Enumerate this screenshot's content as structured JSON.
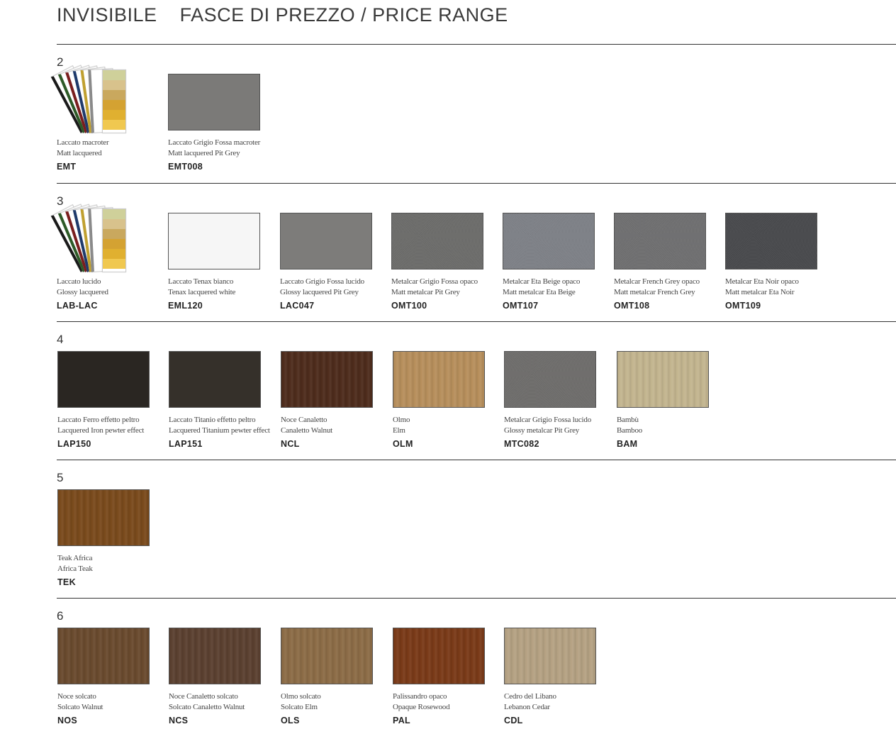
{
  "header": {
    "brand": "INVISIBILE",
    "title": "FASCE DI PREZZO  / PRICE RANGE"
  },
  "bands": [
    {
      "number": "2",
      "items": [
        {
          "line1": "Laccato macroter",
          "line2": "Matt lacquered",
          "code": "EMT",
          "kind": "fan"
        },
        {
          "line1": "Laccato Grigio Fossa macroter",
          "line2": "Matt lacquered Pit Grey",
          "code": "EMT008",
          "kind": "swatch",
          "color": "#7b7a78"
        }
      ]
    },
    {
      "number": "3",
      "items": [
        {
          "line1": "Laccato lucido",
          "line2": "Glossy lacquered",
          "code": "LAB-LAC",
          "kind": "fan"
        },
        {
          "line1": "Laccato Tenax bianco",
          "line2": "Tenax lacquered white",
          "code": "EML120",
          "kind": "swatch",
          "color": "#f6f6f6"
        },
        {
          "line1": "Laccato Grigio Fossa lucido",
          "line2": "Glossy lacquered Pit Grey",
          "code": "LAC047",
          "kind": "swatch",
          "color": "#7d7c7a"
        },
        {
          "line1": "Metalcar Grigio Fossa opaco",
          "line2": "Matt metalcar Pit Grey",
          "code": "OMT100",
          "kind": "swatch",
          "color": "#6c6c6a"
        },
        {
          "line1": "Metalcar Eta Beige opaco",
          "line2": "Matt metalcar Eta Beige",
          "code": "OMT107",
          "kind": "swatch",
          "color": "#7e8187"
        },
        {
          "line1": "Metalcar French Grey opaco",
          "line2": "Matt metalcar French Grey",
          "code": "OMT108",
          "kind": "swatch",
          "color": "#6f6f70"
        },
        {
          "line1": "Metalcar Eta Noir opaco",
          "line2": "Matt metalcar Eta Noir",
          "code": "OMT109",
          "kind": "swatch",
          "color": "#48494c"
        }
      ]
    },
    {
      "number": "4",
      "items": [
        {
          "line1": "Laccato Ferro effetto peltro",
          "line2": "Lacquered Iron pewter effect",
          "code": "LAP150",
          "kind": "swatch",
          "color": "#2a2622"
        },
        {
          "line1": "Laccato Titanio effetto peltro",
          "line2": "Lacquered Titanium pewter effect",
          "code": "LAP151",
          "kind": "swatch",
          "color": "#35302a"
        },
        {
          "line1": "Noce Canaletto",
          "line2": "Canaletto Walnut",
          "code": "NCL",
          "kind": "swatch",
          "color": "#4e2c1c"
        },
        {
          "line1": "Olmo",
          "line2": "Elm",
          "code": "OLM",
          "kind": "swatch",
          "color": "#b78f5c"
        },
        {
          "line1": "Metalcar Grigio Fossa lucido",
          "line2": "Glossy metalcar Pit Grey",
          "code": "MTC082",
          "kind": "swatch",
          "color": "#6e6d6b"
        },
        {
          "line1": "Bambù",
          "line2": "Bamboo",
          "code": "BAM",
          "kind": "swatch",
          "color": "#c3b58f"
        }
      ]
    },
    {
      "number": "5",
      "items": [
        {
          "line1": "Teak Africa",
          "line2": "Africa Teak",
          "code": "TEK",
          "kind": "swatch",
          "color": "#7a4a1c"
        }
      ]
    },
    {
      "number": "6",
      "items": [
        {
          "line1": "Noce solcato",
          "line2": "Solcato Walnut",
          "code": "NOS",
          "kind": "swatch",
          "color": "#6a4a2e"
        },
        {
          "line1": "Noce Canaletto solcato",
          "line2": "Solcato Canaletto Walnut",
          "code": "NCS",
          "kind": "swatch",
          "color": "#5b4030"
        },
        {
          "line1": "Olmo solcato",
          "line2": "Solcato Elm",
          "code": "OLS",
          "kind": "swatch",
          "color": "#8c6c46"
        },
        {
          "line1": "Palissandro opaco",
          "line2": "Opaque Rosewood",
          "code": "PAL",
          "kind": "swatch",
          "color": "#7a3a18"
        },
        {
          "line1": "Cedro del Libano",
          "line2": "Lebanon Cedar",
          "code": "CDL",
          "kind": "swatch",
          "color": "#b5a283"
        }
      ]
    }
  ]
}
